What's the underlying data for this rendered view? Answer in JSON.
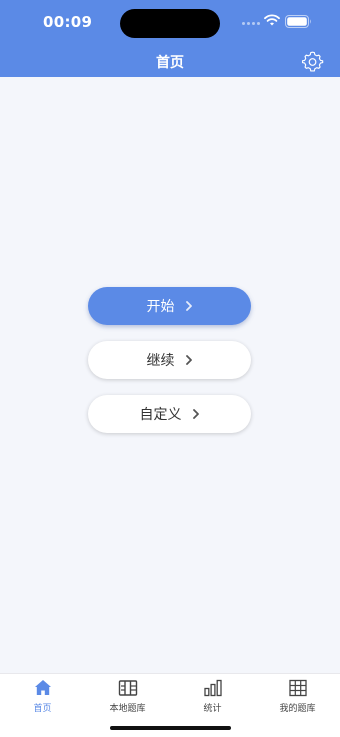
{
  "status_bar": {
    "time": "00:09",
    "icons": [
      "signal-dots-icon",
      "wifi-icon",
      "battery-icon"
    ]
  },
  "header": {
    "title": "首页",
    "settings_icon": "gear-icon"
  },
  "main": {
    "buttons": [
      {
        "label": "开始",
        "style": "primary"
      },
      {
        "label": "继续",
        "style": "secondary"
      },
      {
        "label": "自定义",
        "style": "secondary"
      }
    ]
  },
  "tabbar": {
    "items": [
      {
        "label": "首页",
        "icon": "home-icon",
        "active": true
      },
      {
        "label": "本地题库",
        "icon": "local-bank-icon",
        "active": false
      },
      {
        "label": "统计",
        "icon": "bar-chart-icon",
        "active": false
      },
      {
        "label": "我的题库",
        "icon": "grid-icon",
        "active": false
      }
    ]
  },
  "colors": {
    "accent": "#5b8ae6",
    "background": "#f4f6fb",
    "text": "#333333"
  }
}
